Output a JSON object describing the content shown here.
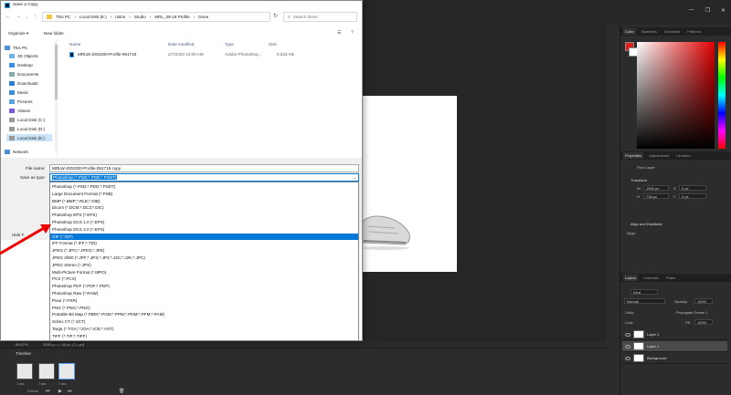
{
  "dialog": {
    "title": "Save a Copy",
    "breadcrumb": [
      "This PC",
      "Local Disk (E:)",
      "milon",
      "Studio",
      "MRL_09-18 Profile",
      "Done"
    ],
    "search_placeholder": "Search Done",
    "organize": "Organize ▾",
    "new_folder": "New folder",
    "columns": {
      "name": "Name",
      "date": "Date modified",
      "type": "Type",
      "size": "Size"
    },
    "file": {
      "name": "MRLW-J002200-Profile-091719",
      "date": "2/7/2023 12:09 AM",
      "type": "Adobe Photoshop...",
      "size": "8,533 KB"
    },
    "sidebar": [
      {
        "label": "This PC",
        "icon": "computer-icon"
      },
      {
        "label": "3D Objects",
        "icon": "cube-icon"
      },
      {
        "label": "Desktop",
        "icon": "desktop-icon"
      },
      {
        "label": "Documents",
        "icon": "document-icon"
      },
      {
        "label": "Downloads",
        "icon": "download-icon"
      },
      {
        "label": "Music",
        "icon": "music-icon"
      },
      {
        "label": "Pictures",
        "icon": "picture-icon"
      },
      {
        "label": "Videos",
        "icon": "video-icon"
      },
      {
        "label": "Local Disk (C:)",
        "icon": "drive-icon"
      },
      {
        "label": "Local Disk (D:)",
        "icon": "drive-icon"
      },
      {
        "label": "Local Disk (E:)",
        "icon": "drive-icon"
      },
      {
        "label": "Network",
        "icon": "network-icon"
      }
    ],
    "file_name_label": "File name:",
    "file_name_value": "MRLW-J002200-Profile-091719 copy",
    "save_type_label": "Save as type:",
    "save_type_value": "Photoshop (*.PSD;*.PDD;*.PSDT)",
    "hide_folders": "Hide F",
    "file_types": [
      "Photoshop (*.PSD;*.PDD;*.PSDT)",
      "Large Document Format (*.PSB)",
      "BMP (*.BMP;*.RLE;*.DIB)",
      "Dicom (*.DCM;*.DC3;*.DIC)",
      "Photoshop EPS (*.EPS)",
      "Photoshop DCS 1.0 (*.EPS)",
      "Photoshop DCS 2.0 (*.EPS)",
      "GIF (*.GIF)",
      "IFF Format (*.IFF;*.TDI)",
      "JPEG (*.JPG;*.JPEG;*.JPE)",
      "JPEG 2000 (*.JPF;*.JPX;*.JP2;*.J2C;*.J2K;*.JPC)",
      "JPEG Stereo (*.JPS)",
      "Multi-Picture Format (*.MPO)",
      "PCX (*.PCX)",
      "Photoshop PDF (*.PDF;*.PDP)",
      "Photoshop Raw (*.RAW)",
      "Pixar (*.PXR)",
      "PNG (*.PNG;*.PNG)",
      "Portable Bit Map (*.PBM;*.PGM;*.PPM;*.PNM;*.PFM;*.PAM)",
      "Scitex CT (*.SCT)",
      "Targa (*.TGA;*.VDA;*.ICB;*.VST)",
      "TIFF (*.TIF;*.TIFF)",
      "WebP (*.WEBP)"
    ],
    "selected_type_index": 7
  },
  "status": {
    "zoom": "66.67%",
    "doc_size": "3200 px x 738 px (72 ppi)"
  },
  "timeline": {
    "title": "Timeline",
    "frames": [
      "1",
      "2",
      "3"
    ],
    "frame_delay": "7 sec.",
    "loop": "Forever"
  },
  "panels": {
    "color_tabs": [
      "Color",
      "Swatches",
      "Gradients",
      "Patterns"
    ],
    "props_tabs": [
      "Properties",
      "Adjustments",
      "Libraries"
    ],
    "pixel_layer": "Pixel Layer",
    "transform": "Transform",
    "w_label": "W",
    "w_value": "1500 px",
    "h_label": "H",
    "h_value": "738 px",
    "x_label": "X",
    "x_value": "0 px",
    "y_label": "Y",
    "y_value": "0 px",
    "align": "Align and Distribute",
    "align_sub": "Align:",
    "layers_tabs": [
      "Layers",
      "Channels",
      "Paths"
    ],
    "kind": "Kind",
    "blend": "Normal",
    "opacity_label": "Opacity:",
    "opacity_value": "100%",
    "unify": "Unify:",
    "propagate": "Propagate Frame 1",
    "lock": "Lock:",
    "fill_label": "Fill:",
    "fill_value": "100%",
    "layers": [
      "Layer 2",
      "Layer 1",
      "Background"
    ],
    "fg_color": "#e02020",
    "bg_color": "#ffffff",
    "accent": "#0078d7"
  }
}
